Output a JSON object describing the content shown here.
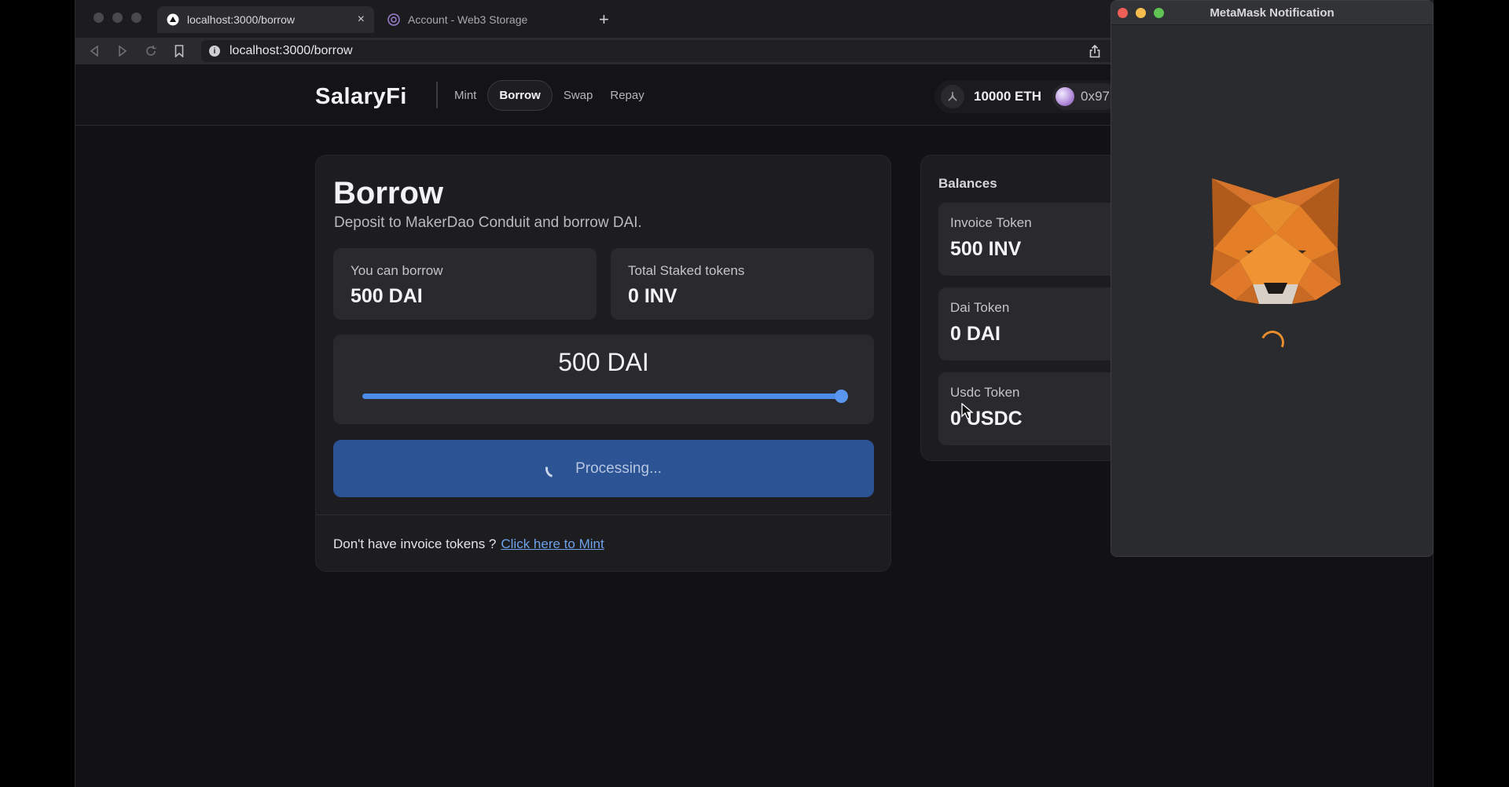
{
  "browser": {
    "tabs": [
      {
        "title": "localhost:3000/borrow",
        "active": true
      },
      {
        "title": "Account - Web3 Storage",
        "active": false
      }
    ],
    "new_tab_label": "+",
    "close_label": "×",
    "url": "localhost:3000/borrow"
  },
  "header": {
    "logo": "SalaryFi",
    "nav": [
      "Mint",
      "Borrow",
      "Swap",
      "Repay"
    ],
    "active_nav": "Borrow",
    "eth_balance": "10000 ETH",
    "account": "0x97"
  },
  "borrow": {
    "title": "Borrow",
    "subtitle": "Deposit to MakerDao Conduit and borrow DAI.",
    "can_borrow_label": "You can borrow",
    "can_borrow_value": "500 DAI",
    "staked_label": "Total Staked tokens",
    "staked_value": "0 INV",
    "amount": "500 DAI",
    "slider_fraction": 1.0,
    "button_label": "Processing...",
    "footer_text": "Don't have invoice tokens ?",
    "footer_link": "Click here to Mint"
  },
  "balances": {
    "title": "Balances",
    "items": [
      {
        "label": "Invoice Token",
        "value": "500 INV"
      },
      {
        "label": "Dai Token",
        "value": "0 DAI"
      },
      {
        "label": "Usdc Token",
        "value": "0 USDC"
      }
    ]
  },
  "metamask": {
    "title": "MetaMask Notification"
  },
  "colors": {
    "accent": "#4d8be8",
    "button": "#2c5394",
    "metamask_orange": "#e88d2d"
  }
}
